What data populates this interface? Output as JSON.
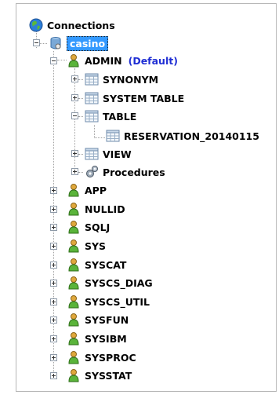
{
  "tree": {
    "root_label": "Connections",
    "connection_label": "casino",
    "schemas": [
      {
        "label": "ADMIN",
        "tag": "(Default)"
      },
      {
        "label": "APP"
      },
      {
        "label": "NULLID"
      },
      {
        "label": "SQLJ"
      },
      {
        "label": "SYS"
      },
      {
        "label": "SYSCAT"
      },
      {
        "label": "SYSCS_DIAG"
      },
      {
        "label": "SYSCS_UTIL"
      },
      {
        "label": "SYSFUN"
      },
      {
        "label": "SYSIBM"
      },
      {
        "label": "SYSPROC"
      },
      {
        "label": "SYSSTAT"
      }
    ],
    "admin_children": [
      {
        "label": "SYNONYM"
      },
      {
        "label": "SYSTEM TABLE"
      },
      {
        "label": "TABLE"
      },
      {
        "label": "VIEW"
      },
      {
        "label": "Procedures"
      }
    ],
    "tables": [
      {
        "label": "RESERVATION_20140115"
      }
    ]
  },
  "colors": {
    "selection": "#3399ff",
    "default_tag": "#1f2ed4",
    "tree_line": "#a0a0a0"
  },
  "icons": {
    "root": "globe-icon",
    "connection": "database-icon",
    "schema": "user-icon",
    "folder": "table-grid-icon",
    "table": "table-grid-icon",
    "procedures": "gears-icon"
  }
}
